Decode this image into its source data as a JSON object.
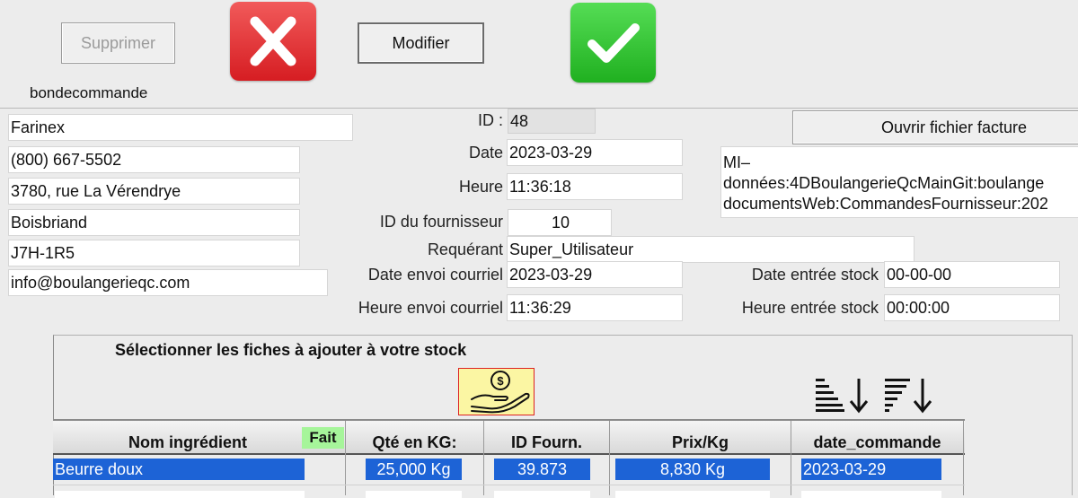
{
  "toolbar": {
    "delete_label": "Supprimer",
    "modify_label": "Modifier",
    "cancel_icon": "red-x-icon",
    "confirm_icon": "green-check-icon"
  },
  "form_name": "bondecommande",
  "supplier": {
    "name": "Farinex",
    "phone": "(800) 667-5502",
    "address": "3780, rue La Vérendrye",
    "city": "Boisbriand",
    "postal": "J7H-1R5",
    "email": "info@boulangerieqc.com"
  },
  "order": {
    "id_label": "ID :",
    "id_value": "48",
    "date_label": "Date",
    "date_value": "2023-03-29",
    "time_label": "Heure",
    "time_value": "11:36:18",
    "supplier_id_label": "ID du fournisseur",
    "supplier_id_value": "10",
    "requester_label": "Requérant",
    "requester_value": "Super_Utilisateur",
    "email_date_label": "Date envoi courriel",
    "email_date_value": "2023-03-29",
    "email_time_label": "Heure envoi courriel",
    "email_time_value": "11:36:29",
    "stock_date_label": "Date entrée stock",
    "stock_date_value": "00-00-00",
    "stock_time_label": "Heure entrée stock",
    "stock_time_value": "00:00:00"
  },
  "invoice": {
    "open_label": "Ouvrir fichier facture",
    "path_line1": "MI–",
    "path_line2": "données:4DBoulangerieQcMainGit:boulange",
    "path_line3": "documentsWeb:CommandesFournisseur:202"
  },
  "stock_panel": {
    "instruction": "Sélectionner les fiches à ajouter à votre stock",
    "pay_icon": "hand-coin-icon",
    "sort_asc_icon": "sort-ascending-icon",
    "sort_desc_icon": "sort-descending-icon"
  },
  "table": {
    "headers": {
      "name": "Nom ingrédient",
      "done": "Fait",
      "qty": "Qté en KG:",
      "supplier_id": "ID Fourn.",
      "price": "Prix/Kg",
      "date": "date_commande"
    },
    "rows": [
      {
        "name": "Beurre doux",
        "qty": "25,000 Kg",
        "supplier_id": "39.873",
        "price": "8,830 Kg",
        "date": "2023-03-29"
      }
    ]
  },
  "colors": {
    "selection": "#1d63d6",
    "cancel_red": "#e0262b",
    "confirm_green": "#2fc12f",
    "fait_badge": "#a6f59a",
    "pay_icon_bg": "#fbf6a3"
  }
}
